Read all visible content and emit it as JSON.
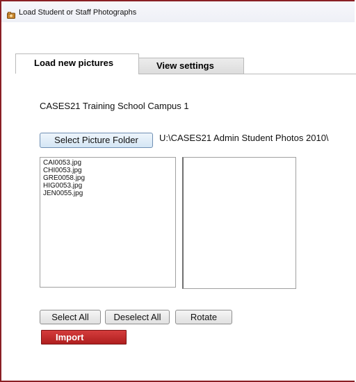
{
  "window": {
    "title": "Load Student or Staff Photographs"
  },
  "tabs": [
    {
      "label": "Load new pictures",
      "active": true
    },
    {
      "label": "View settings",
      "active": false
    }
  ],
  "school": {
    "name": "CASES21 Training School Campus 1"
  },
  "folder": {
    "button_label": "Select Picture Folder",
    "path": "U:\\CASES21 Admin Student Photos 2010\\"
  },
  "files": {
    "items": [
      "CAI0053.jpg",
      "CHI0053.jpg",
      "GRE0058.jpg",
      "HIG0053.jpg",
      "JEN0055.jpg"
    ]
  },
  "actions": {
    "select_all": "Select All",
    "deselect_all": "Deselect All",
    "rotate": "Rotate",
    "import": "Import"
  },
  "colors": {
    "window_border": "#8a1f24",
    "import_button": "#c62b2b",
    "folder_button": "#d4e6f5"
  },
  "icons": {
    "title": "app-icon"
  }
}
